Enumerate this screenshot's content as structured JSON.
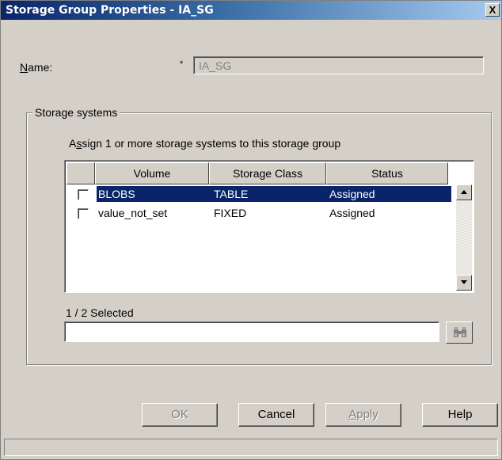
{
  "window": {
    "title": "Storage Group Properties - IA_SG",
    "close_glyph": "X"
  },
  "name_field": {
    "label": "Name:",
    "required_marker": "*",
    "value": "IA_SG"
  },
  "storage_systems": {
    "group_title": "Storage systems",
    "instruction": "Assign 1 or more storage systems to this storage group",
    "columns": [
      "",
      "Volume",
      "Storage Class",
      "Status"
    ],
    "rows": [
      {
        "volume": "BLOBS",
        "storage_class": "TABLE",
        "status": "Assigned",
        "checked": false,
        "selected": true
      },
      {
        "volume": "value_not_set",
        "storage_class": "FIXED",
        "status": "Assigned",
        "checked": false,
        "selected": false
      }
    ],
    "selected_count": "1 / 2 Selected",
    "filter_value": ""
  },
  "buttons": {
    "ok": "OK",
    "cancel": "Cancel",
    "apply": "Apply",
    "help": "Help"
  },
  "colors": {
    "dialog_bg": "#d4d0c8",
    "selection": "#0a246a",
    "title_start": "#0a246a",
    "title_end": "#a6caf0"
  }
}
